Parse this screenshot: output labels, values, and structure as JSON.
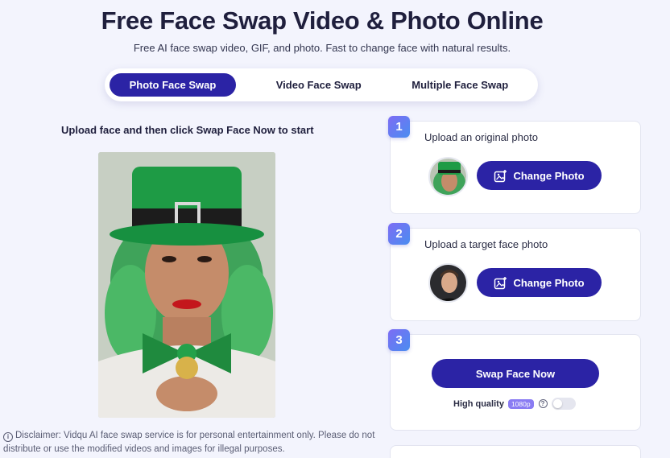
{
  "header": {
    "title": "Free Face Swap Video & Photo Online",
    "subtitle": "Free AI face swap video, GIF, and photo. Fast to change face with natural results."
  },
  "tabs": [
    {
      "label": "Photo Face Swap",
      "active": true
    },
    {
      "label": "Video Face Swap",
      "active": false
    },
    {
      "label": "Multiple Face Swap",
      "active": false
    }
  ],
  "left": {
    "heading": "Upload face and then click Swap Face Now to start",
    "disclaimer": "Disclaimer: Vidqu AI face swap service is for personal entertainment only. Please do not distribute or use the modified videos and images for illegal purposes."
  },
  "steps": [
    {
      "number": "1",
      "label": "Upload an original photo",
      "button": "Change Photo"
    },
    {
      "number": "2",
      "label": "Upload a target face photo",
      "button": "Change Photo"
    },
    {
      "number": "3",
      "button": "Swap Face Now",
      "quality_label": "High quality",
      "quality_badge": "1080p",
      "help": "?",
      "hq_enabled": false
    }
  ],
  "colors": {
    "primary": "#2b23a5",
    "background": "#f3f4fd",
    "badge_gradient_start": "#7d6cf4",
    "badge_gradient_end": "#4a8df0"
  }
}
